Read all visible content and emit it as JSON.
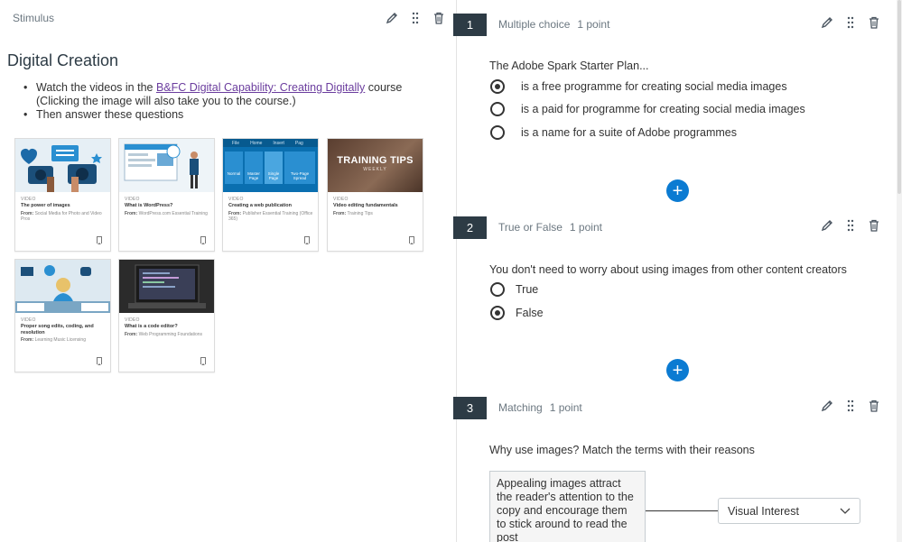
{
  "stimulus": {
    "label": "Stimulus",
    "title": "Digital Creation",
    "bullet1_pre": "Watch the videos in the ",
    "bullet1_link": "B&FC Digital Capability: Creating Digitally",
    "bullet1_post": " course",
    "bullet1_line2": "(Clicking the image will also take you to the course.)",
    "bullet2": "Then answer these questions",
    "cards": [
      {
        "tag": "VIDEO",
        "title": "The power of images",
        "from_label": "From:",
        "from": "Social Media for Photo and Video Pros"
      },
      {
        "tag": "VIDEO",
        "title": "What is WordPress?",
        "from_label": "From:",
        "from": "WordPress.com Essential Training"
      },
      {
        "tag": "VIDEO",
        "title": "Creating a web publication",
        "from_label": "From:",
        "from": "Publisher Essential Training (Office 365)"
      },
      {
        "tag": "VIDEO",
        "title": "Video editing fundamentals",
        "from_label": "From:",
        "from": "Training Tips"
      },
      {
        "tag": "VIDEO",
        "title": "Proper song edits, coding, and resolution",
        "from_label": "From:",
        "from": "Learning Music Licensing"
      },
      {
        "tag": "VIDEO",
        "title": "What is a code editor?",
        "from_label": "From:",
        "from": "Web Programming Foundations"
      }
    ],
    "thumb3_menu": [
      "File",
      "Home",
      "Insert",
      "Pag"
    ],
    "thumb3_tiles": [
      "Normal",
      "Master Page",
      "Single Page",
      "Two-Page Spread"
    ],
    "thumb4_headline": "TRAINING TIPS",
    "thumb4_sub": "WEEKLY"
  },
  "questions": [
    {
      "number": "1",
      "type": "Multiple choice",
      "points": "1 point",
      "text": "The Adobe Spark Starter Plan...",
      "options": [
        {
          "label": "is a free programme for creating social media images",
          "selected": true
        },
        {
          "label": "is a paid for programme for creating social media images",
          "selected": false
        },
        {
          "label": "is a name for a suite of Adobe programmes",
          "selected": false
        }
      ]
    },
    {
      "number": "2",
      "type": "True or False",
      "points": "1 point",
      "text": "You don't need to worry about using images from other content creators",
      "options": [
        {
          "label": "True",
          "selected": false
        },
        {
          "label": "False",
          "selected": true
        }
      ]
    },
    {
      "number": "3",
      "type": "Matching",
      "points": "1 point",
      "text": "Why use images? Match the terms with their reasons",
      "match_prompt": "Appealing images attract the reader's attention to the copy and encourage them to stick around to read the post",
      "match_answer": "Visual Interest"
    }
  ],
  "add_button_symbol": "+",
  "icons": [
    "pencil-icon",
    "drag-handle-icon",
    "trash-icon",
    "plus-icon",
    "chevron-down-icon",
    "bookmark-icon"
  ],
  "colors": {
    "accent": "#0b7bd2",
    "number_badge": "#2d3b45",
    "link": "#6b3d9e"
  }
}
